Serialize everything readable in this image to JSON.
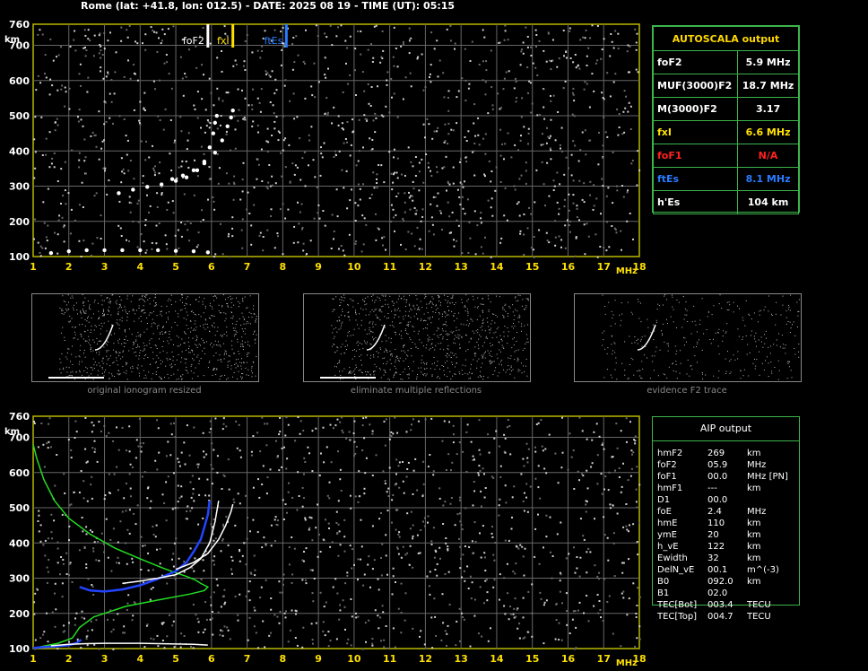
{
  "header": "Rome (lat: +41.8, lon: 012.5) - DATE: 2025 08 19 - TIME (UT): 05:15",
  "chart_data": [
    {
      "type": "scatter",
      "title": "",
      "xlabel": "MHz",
      "ylabel": "km",
      "xlim": [
        1,
        18
      ],
      "ylim": [
        100,
        760
      ],
      "xticks": [
        1,
        2,
        3,
        4,
        5,
        6,
        7,
        8,
        9,
        10,
        11,
        12,
        13,
        14,
        15,
        16,
        17,
        18
      ],
      "yticks": [
        100,
        200,
        300,
        400,
        500,
        600,
        700,
        760
      ],
      "grid": true,
      "markers": [
        {
          "label": "foF2",
          "x": 5.9,
          "color": "#ffffff"
        },
        {
          "label": "fxI",
          "x": 6.6,
          "color": "#ffe000"
        },
        {
          "label": "ftEs",
          "x": 8.1,
          "color": "#2a7bff"
        }
      ],
      "series": [
        {
          "name": "",
          "color": "#ffffff",
          "x": [
            3.4,
            3.8,
            4.2,
            4.6,
            5.0,
            5.3,
            5.6,
            5.8,
            5.95,
            6.05,
            6.1,
            6.15
          ],
          "y": [
            280,
            290,
            298,
            305,
            315,
            325,
            345,
            370,
            410,
            450,
            480,
            500
          ]
        },
        {
          "name": "",
          "color": "#ffffff",
          "x": [
            4.9,
            5.2,
            5.5,
            5.8,
            6.1,
            6.3,
            6.45,
            6.55,
            6.6
          ],
          "y": [
            320,
            330,
            345,
            365,
            395,
            430,
            470,
            495,
            515
          ]
        },
        {
          "name": "",
          "color": "#ffffff",
          "x": [
            1.5,
            2.0,
            2.5,
            3.0,
            3.5,
            4.0,
            4.5,
            5.0,
            5.5,
            5.9
          ],
          "y": [
            110,
            115,
            118,
            118,
            118,
            118,
            118,
            116,
            115,
            112
          ]
        }
      ]
    },
    {
      "type": "line",
      "title": "",
      "xlabel": "MHz",
      "ylabel": "km",
      "xlim": [
        1,
        18
      ],
      "ylim": [
        100,
        760
      ],
      "xticks": [
        1,
        2,
        3,
        4,
        5,
        6,
        7,
        8,
        9,
        10,
        11,
        12,
        13,
        14,
        15,
        16,
        17,
        18
      ],
      "yticks": [
        100,
        200,
        300,
        400,
        500,
        600,
        700,
        760
      ],
      "grid": true,
      "series": [
        {
          "name": "",
          "color": "#22dd22",
          "x": [
            1.0,
            1.1,
            1.3,
            1.6,
            2.0,
            2.6,
            3.3,
            4.0,
            4.6,
            5.0,
            5.3,
            5.55,
            5.7,
            5.9,
            5.8,
            5.4,
            4.6,
            3.6,
            2.7,
            2.3,
            2.1,
            1.7,
            1.2,
            1.0
          ],
          "y": [
            680,
            640,
            580,
            520,
            470,
            425,
            385,
            355,
            330,
            315,
            305,
            295,
            285,
            275,
            265,
            255,
            240,
            220,
            190,
            160,
            130,
            115,
            105,
            100
          ]
        },
        {
          "name": "",
          "color": "#2244ff",
          "x": [
            2.3,
            2.6,
            3.0,
            3.5,
            4.0,
            4.5,
            5.0,
            5.3,
            5.5,
            5.7,
            5.8,
            5.9,
            5.95
          ],
          "y": [
            275,
            265,
            262,
            268,
            280,
            298,
            320,
            345,
            375,
            410,
            445,
            480,
            520
          ]
        },
        {
          "name": "",
          "color": "#2244ff",
          "x": [
            1.0,
            1.3,
            1.6,
            2.0,
            2.2,
            2.35
          ],
          "y": [
            102,
            104,
            106,
            110,
            115,
            125
          ]
        },
        {
          "name": "",
          "color": "#ffffff",
          "x": [
            3.5,
            4.0,
            4.5,
            5.0,
            5.4,
            5.7,
            5.95,
            6.1,
            6.2
          ],
          "y": [
            285,
            292,
            300,
            310,
            330,
            355,
            400,
            460,
            520
          ]
        },
        {
          "name": "",
          "color": "#ffffff",
          "x": [
            5.0,
            5.5,
            5.9,
            6.2,
            6.4,
            6.55,
            6.6
          ],
          "y": [
            325,
            345,
            370,
            410,
            450,
            490,
            510
          ]
        },
        {
          "name": "",
          "color": "#ffffff",
          "x": [
            1.5,
            2.0,
            2.5,
            3.0,
            3.5,
            4.0,
            4.5,
            5.0,
            5.5,
            5.9
          ],
          "y": [
            108,
            112,
            114,
            115,
            115,
            115,
            114,
            113,
            112,
            110
          ]
        }
      ]
    }
  ],
  "thumbnails": [
    {
      "caption": "original ionogram resized"
    },
    {
      "caption": "eliminate multiple reflections"
    },
    {
      "caption": "evidence F2 trace"
    }
  ],
  "autoscala": {
    "title": "AUTOSCALA output",
    "rows": [
      {
        "label": "foF2",
        "value": "5.9 MHz",
        "color": "#ffffff"
      },
      {
        "label": "MUF(3000)F2",
        "value": "18.7 MHz",
        "color": "#ffffff"
      },
      {
        "label": "M(3000)F2",
        "value": "3.17",
        "color": "#ffffff"
      },
      {
        "label": "fxI",
        "value": "6.6 MHz",
        "color": "#ffe000"
      },
      {
        "label": "foF1",
        "value": "N/A",
        "color": "#ff2020"
      },
      {
        "label": "ftEs",
        "value": "8.1 MHz",
        "color": "#2a7bff"
      },
      {
        "label": "h'Es",
        "value": "104    km",
        "color": "#ffffff"
      }
    ]
  },
  "aip": {
    "title": "AIP output",
    "rows": [
      {
        "label": "hmF2",
        "value": "269",
        "unit": "km"
      },
      {
        "label": "foF2",
        "value": "05.9",
        "unit": "MHz"
      },
      {
        "label": "foF1",
        "value": "00.0",
        "unit": "MHz    [PN]"
      },
      {
        "label": "hmF1",
        "value": "---",
        "unit": "km"
      },
      {
        "label": "D1",
        "value": "00.0",
        "unit": ""
      },
      {
        "label": "foE",
        "value": "2.4",
        "unit": "MHz"
      },
      {
        "label": "hmE",
        "value": "110",
        "unit": "km"
      },
      {
        "label": "ymE",
        "value": "20",
        "unit": "km"
      },
      {
        "label": "h_vE",
        "value": "122",
        "unit": "km"
      },
      {
        "label": "Ewidth",
        "value": "32",
        "unit": "km"
      },
      {
        "label": "DelN_vE",
        "value": "00.1",
        "unit": "m^(-3)"
      },
      {
        "label": "B0",
        "value": "092.0",
        "unit": "km"
      },
      {
        "label": "B1",
        "value": "02.0",
        "unit": ""
      },
      {
        "label": "TEC[Bot]",
        "value": "003.4",
        "unit": "TECU"
      },
      {
        "label": "TEC[Top]",
        "value": "004.7",
        "unit": "TECU"
      }
    ]
  }
}
